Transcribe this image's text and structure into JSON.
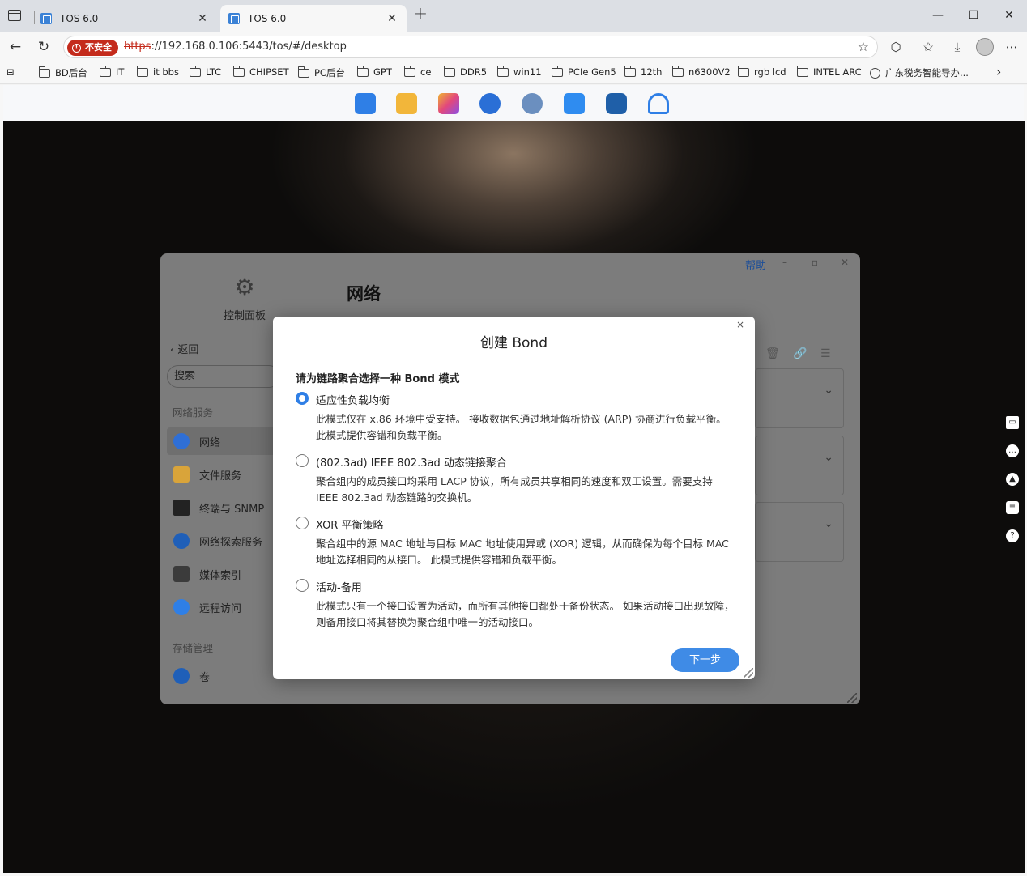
{
  "browser": {
    "tabs": [
      {
        "title": "TOS 6.0",
        "close": "✕"
      },
      {
        "title": "TOS 6.0",
        "close": "✕"
      }
    ],
    "new_tab": "+",
    "window_controls": {
      "minimize": "—",
      "maximize": "☐",
      "close": "✕"
    },
    "address": {
      "security_badge": "不安全",
      "scheme": "https",
      "rest": "://192.168.0.106:5443/tos/#/desktop"
    },
    "bookmarks": [
      {
        "label": "BD后台",
        "icon": "folder-icon"
      },
      {
        "label": "IT",
        "icon": "folder-icon"
      },
      {
        "label": "it bbs",
        "icon": "folder-icon"
      },
      {
        "label": "LTC",
        "icon": "folder-icon"
      },
      {
        "label": "CHIPSET",
        "icon": "folder-icon"
      },
      {
        "label": "PC后台",
        "icon": "folder-icon"
      },
      {
        "label": "GPT",
        "icon": "folder-icon"
      },
      {
        "label": "ce",
        "icon": "folder-icon"
      },
      {
        "label": "DDR5",
        "icon": "folder-icon"
      },
      {
        "label": "win11",
        "icon": "folder-icon"
      },
      {
        "label": "PCIe Gen5",
        "icon": "folder-icon"
      },
      {
        "label": "12th",
        "icon": "folder-icon"
      },
      {
        "label": "n6300V2",
        "icon": "folder-icon"
      },
      {
        "label": "rgb lcd",
        "icon": "folder-icon"
      },
      {
        "label": "INTEL ARC",
        "icon": "folder-icon"
      },
      {
        "label": "广东税务智能导办...",
        "icon": "globe-icon"
      }
    ],
    "bookmarks_more": "›"
  },
  "dock": {
    "icons": [
      {
        "name": "app-center-icon",
        "color": "#2f7fe6"
      },
      {
        "name": "file-manager-icon",
        "color": "#f2b63a"
      },
      {
        "name": "photos-icon",
        "color": "#c04de0"
      },
      {
        "name": "backup-icon",
        "color": "#2a6fd6"
      },
      {
        "name": "settings-icon",
        "color": "#4a7fc1"
      },
      {
        "name": "mail-icon",
        "color": "#2f8cf0"
      },
      {
        "name": "docker-icon",
        "color": "#1f5fa8"
      },
      {
        "name": "support-icon",
        "color": "#2f7fe6"
      }
    ]
  },
  "control_panel": {
    "title": "控制面板",
    "back": "返回",
    "search_placeholder": "搜索",
    "help": "帮助",
    "main_title": "网络",
    "groups": [
      {
        "label": "网络服务",
        "items": [
          {
            "label": "网络",
            "selected": true,
            "color": "#2f6fd6"
          },
          {
            "label": "文件服务",
            "selected": false,
            "color": "#d9a43a"
          },
          {
            "label": "终端与 SNMP",
            "selected": false,
            "color": "#222222"
          },
          {
            "label": "网络探索服务",
            "selected": false,
            "color": "#1f5fb8"
          },
          {
            "label": "媒体索引",
            "selected": false,
            "color": "#3b3b3b"
          },
          {
            "label": "远程访问",
            "selected": false,
            "color": "#2f7fe6"
          }
        ]
      },
      {
        "label": "存储管理",
        "items": [
          {
            "label": "卷",
            "selected": false,
            "color": "#1f5fb8"
          }
        ]
      }
    ]
  },
  "modal": {
    "title": "创建 Bond",
    "close": "×",
    "prompt": "请为链路聚合选择一种 Bond 模式",
    "options": [
      {
        "label": "适应性负载均衡",
        "checked": true,
        "desc": "此模式仅在 x.86 环境中受支持。 接收数据包通过地址解析协议 (ARP) 协商进行负载平衡。 此模式提供容错和负载平衡。"
      },
      {
        "label": "(802.3ad) IEEE 802.3ad 动态链接聚合",
        "checked": false,
        "desc": "聚合组内的成员接口均采用 LACP 协议，所有成员共享相同的速度和双工设置。需要支持 IEEE 802.3ad 动态链路的交换机。"
      },
      {
        "label": "XOR 平衡策略",
        "checked": false,
        "desc": "聚合组中的源 MAC 地址与目标 MAC 地址使用异或 (XOR) 逻辑，从而确保为每个目标 MAC 地址选择相同的从接口。 此模式提供容错和负载平衡。"
      },
      {
        "label": "活动-备用",
        "checked": false,
        "desc": "此模式只有一个接口设置为活动，而所有其他接口都处于备份状态。 如果活动接口出现故障，则备用接口将其替换为聚合组中唯一的活动接口。"
      }
    ],
    "next_button": "下一步"
  }
}
